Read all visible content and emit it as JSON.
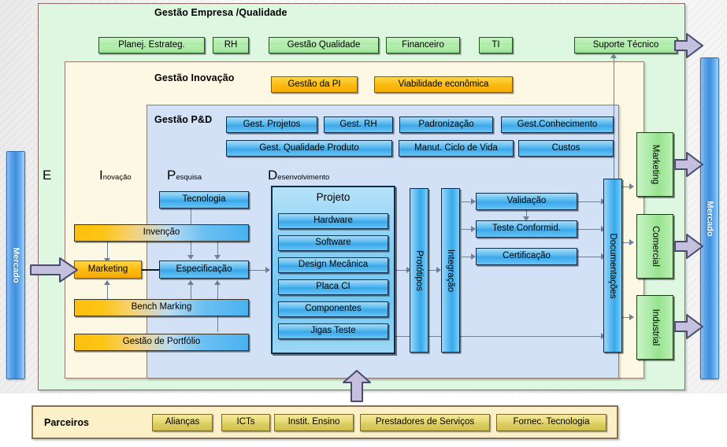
{
  "market": {
    "left_label": "Mercado",
    "right_label": "Mercado"
  },
  "stages": [
    {
      "key": "E",
      "big": "E",
      "small": ""
    },
    {
      "key": "I",
      "big": "I",
      "small": "novação"
    },
    {
      "key": "P",
      "big": "P",
      "small": "esquisa"
    },
    {
      "key": "D",
      "big": "D",
      "small": "esenvolvimento"
    }
  ],
  "enterprise": {
    "title": "Gestão Empresa /Qualidade",
    "buttons": [
      {
        "label": "Planej. Estrateg."
      },
      {
        "label": "RH"
      },
      {
        "label": "Gestão Qualidade"
      },
      {
        "label": "Financeiro"
      },
      {
        "label": "TI"
      },
      {
        "label": "Suporte Técnico"
      }
    ]
  },
  "innovation": {
    "title": "Gestão Inovação",
    "buttons": [
      {
        "label": "Gestão da PI"
      },
      {
        "label": "Viabilidade econômica"
      }
    ]
  },
  "rnd": {
    "title": "Gestão P&D",
    "row1": [
      {
        "label": "Gest. Projetos"
      },
      {
        "label": "Gest. RH"
      },
      {
        "label": "Padronização"
      },
      {
        "label": "Gest.Conhecimento"
      }
    ],
    "row2": [
      {
        "label": "Gest. Qualidade Produto"
      },
      {
        "label": "Manut. Ciclo de Vida"
      },
      {
        "label": "Custos"
      }
    ]
  },
  "flow": {
    "tecnologia": "Tecnologia",
    "invencao": "Invenção",
    "marketing": "Marketing",
    "especificacao": "Especificação",
    "bench_marking": "Bench Marking",
    "gestao_portfolio": "Gestão de Portfólio",
    "projeto_title": "Projeto",
    "projeto_items": [
      {
        "label": "Hardware"
      },
      {
        "label": "Software"
      },
      {
        "label": "Design Mecânica"
      },
      {
        "label": "Placa CI"
      },
      {
        "label": "Componentes"
      },
      {
        "label": "Jigas Teste"
      }
    ],
    "prototipos": "Protótipos",
    "integracao": "Integração",
    "validacao": "Validação",
    "teste_conformidade": "Teste Conformid.",
    "certificacao": "Certificação",
    "documentacoes": "Documentações"
  },
  "outputs": [
    {
      "label": "Marketing"
    },
    {
      "label": "Comercial"
    },
    {
      "label": "Industrial"
    }
  ],
  "partners": {
    "title": "Parceiros",
    "buttons": [
      {
        "label": "Alianças"
      },
      {
        "label": "ICTs"
      },
      {
        "label": "Instit. Ensino"
      },
      {
        "label": "Prestadores de Serviços"
      },
      {
        "label": "Fornec. Tecnologia"
      }
    ]
  },
  "colors": {
    "green_panel": "#ddf7e0",
    "cream_panel": "#fdf8e3",
    "blue_panel": "#d3e1f7",
    "green_button": "#a9eaa4",
    "orange_button": "#fbbc12",
    "blue_button": "#3aa8ea",
    "khaki_button": "#e7d970",
    "market_bar": "#3e8fe0",
    "block_arrow": "#c5c0dd"
  }
}
